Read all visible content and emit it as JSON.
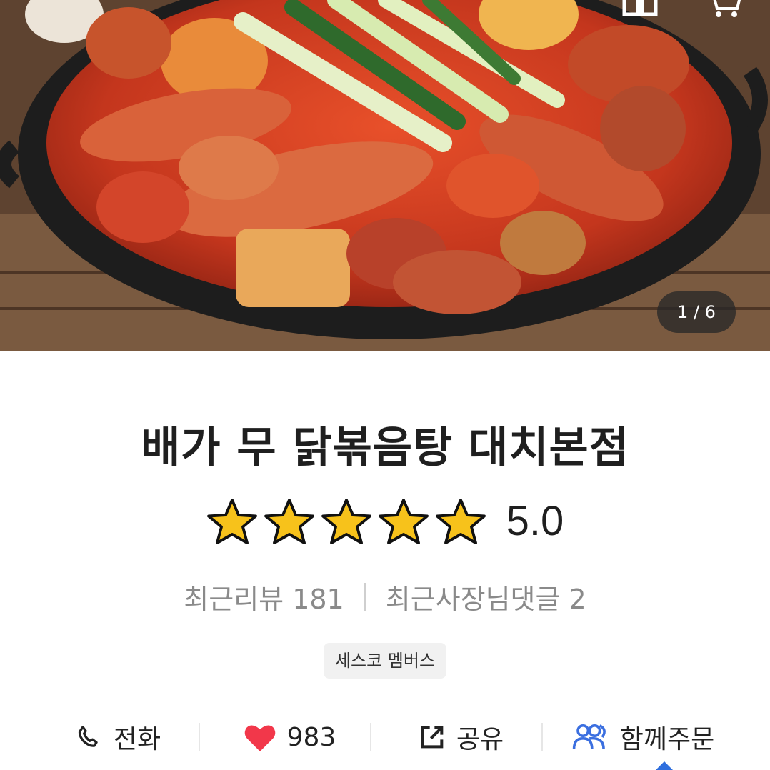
{
  "hero": {
    "image_description_icon": "food-photo-icon",
    "counter": "1 / 6",
    "icons": [
      "home-icon",
      "cart-icon"
    ]
  },
  "store": {
    "name": "배가 무 닭볶음탕 대치본점",
    "rating": 5.0,
    "rating_text": "5.0",
    "stars_filled": 5,
    "stars_total": 5
  },
  "meta": {
    "reviews_label": "최근리뷰 181",
    "owner_comments_label": "최근사장님댓글 2"
  },
  "badge": "세스코 멤버스",
  "actions": {
    "call": "전화",
    "likes": "983",
    "share": "공유",
    "group_order": "함께주문"
  },
  "colors": {
    "star": "#f7c21b",
    "heart": "#f2374a",
    "group_icon": "#3b6fe0",
    "counter_bg": "#333333"
  }
}
